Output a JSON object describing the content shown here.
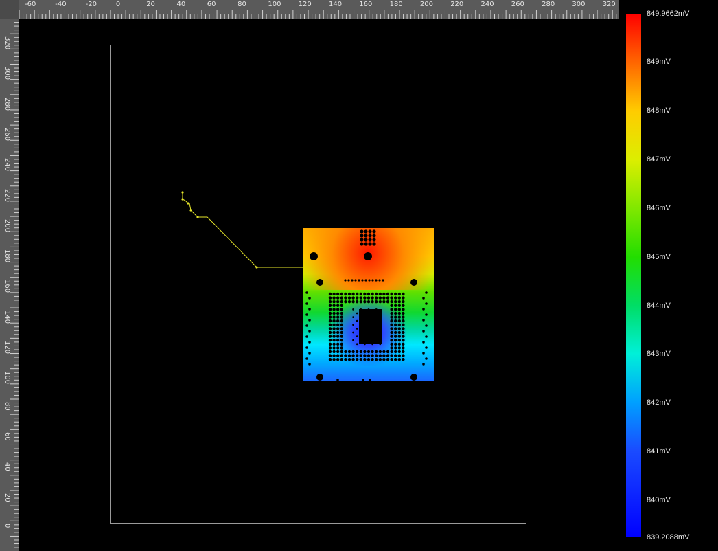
{
  "rulers": {
    "top_labels": [
      "-60",
      "-40",
      "-20",
      "0",
      "20",
      "40",
      "60",
      "80",
      "100",
      "120",
      "140",
      "160",
      "180",
      "200",
      "220",
      "240",
      "260",
      "280",
      "300",
      "320"
    ],
    "left_labels": [
      "320",
      "300",
      "280",
      "260",
      "240",
      "220",
      "200",
      "180",
      "160",
      "140",
      "120",
      "100",
      "80",
      "60",
      "40",
      "20",
      "0"
    ]
  },
  "colorbar": {
    "max_label": "849.9662mV",
    "min_label": "839.2088mV",
    "tick_labels": [
      "849mV",
      "848mV",
      "847mV",
      "846mV",
      "845mV",
      "844mV",
      "843mV",
      "842mV",
      "841mV",
      "840mV"
    ],
    "colors": {
      "max": "#ff0000",
      "mid": "#22dd00",
      "min": "#0000ff"
    }
  },
  "canvas": {
    "background": "#000000",
    "outline_color": "#9a9a9a",
    "trace_color": "#e6e62a"
  }
}
